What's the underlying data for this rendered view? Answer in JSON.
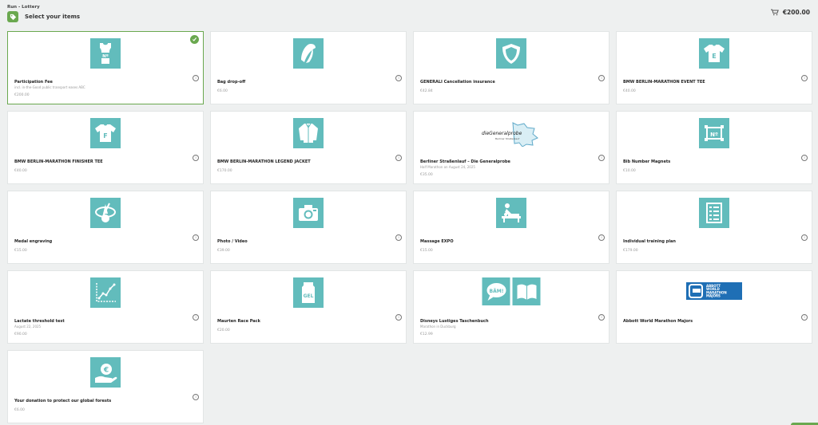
{
  "header": {
    "subtitle": "Run - Lottery",
    "title": "Select your items",
    "cart_total": "€200.00"
  },
  "items": [
    {
      "name": "Participation Fee",
      "desc": "incl. in-the-Good public transport eases ABC",
      "price": "€200.00",
      "icon": "bib-shirt-icon",
      "selected": true
    },
    {
      "name": "Bag drop-off",
      "desc": "",
      "price": "€6.00",
      "icon": "bag-icon"
    },
    {
      "name": "GENERALI Cancellation insurance",
      "desc": "",
      "price": "€42.84",
      "icon": "shield-icon"
    },
    {
      "name": "BMW BERLIN-MARATHON EVENT TEE",
      "desc": "",
      "price": "€40.00",
      "icon": "tee-e-icon"
    },
    {
      "name": "BMW BERLIN-MARATHON FINISHER TEE",
      "desc": "",
      "price": "€40.00",
      "icon": "tee-f-icon"
    },
    {
      "name": "BMW BERLIN-MARATHON LEGEND JACKET",
      "desc": "",
      "price": "€170.00",
      "icon": "jacket-icon"
    },
    {
      "name": "Berliner Straßenlauf – Die Generalprobe",
      "desc": "Half Marathon on August 24, 2025",
      "price": "€35.00",
      "icon": "generalprobe-logo-icon",
      "logo_text": "dieGeneralprobe",
      "logo_sub": "Berliner Straßenlauf"
    },
    {
      "name": "Bib Number Magnets",
      "desc": "",
      "price": "€10.00",
      "icon": "bib-magnets-icon"
    },
    {
      "name": "Medal engraving",
      "desc": "",
      "price": "€15.00",
      "icon": "medal-icon"
    },
    {
      "name": "Photo / Video",
      "desc": "",
      "price": "€39.00",
      "icon": "camera-icon"
    },
    {
      "name": "Massage EXPO",
      "desc": "",
      "price": "€15.00",
      "icon": "massage-icon"
    },
    {
      "name": "Individual training plan",
      "desc": "",
      "price": "€179.00",
      "icon": "training-plan-icon"
    },
    {
      "name": "Lactate threshold test",
      "desc": "August 22, 2025",
      "price": "€90.00",
      "icon": "chart-icon"
    },
    {
      "name": "Maurten Race Pack",
      "desc": "",
      "price": "€20.00",
      "icon": "gel-icon"
    },
    {
      "name": "Disneys Lustiges Taschenbuch",
      "desc": "Marathon in Duckburg",
      "price": "€12.99",
      "icon": "comic-book-icon",
      "bubble": "BÄM!"
    },
    {
      "name": "Abbott World Marathon Majors",
      "desc": "",
      "price": "",
      "icon": "abbott-logo-icon",
      "logo_lines": [
        "ABBOTT",
        "WORLD",
        "MARATHON",
        "MAJORS"
      ]
    },
    {
      "name": "Your donation to protect our global forests",
      "desc": "",
      "price": "€6.00",
      "icon": "euro-hand-icon"
    }
  ],
  "colors": {
    "accent": "#6aa84f",
    "icon_bg": "#62bcbc",
    "abbott_blue": "#1f6fb5"
  }
}
